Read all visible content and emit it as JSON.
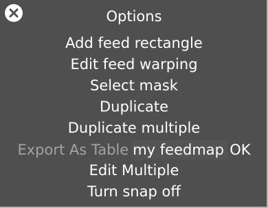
{
  "menu": {
    "title": "Options",
    "items": [
      {
        "label": "Add feed rectangle"
      },
      {
        "label": "Edit feed warping"
      },
      {
        "label": "Select mask"
      },
      {
        "label": "Duplicate"
      },
      {
        "label": "Duplicate multiple"
      }
    ],
    "export": {
      "label": "Export As Table",
      "input_value": "my feedmap",
      "ok_label": "OK"
    },
    "items_after": [
      {
        "label": "Edit Multiple"
      },
      {
        "label": "Turn snap off"
      }
    ]
  },
  "colors": {
    "panel_background": "#4f4f4f",
    "text": "#ffffff",
    "disabled_text": "#a3a3a3",
    "border": "#b4b4b4"
  },
  "icons": {
    "close": "close-icon"
  }
}
